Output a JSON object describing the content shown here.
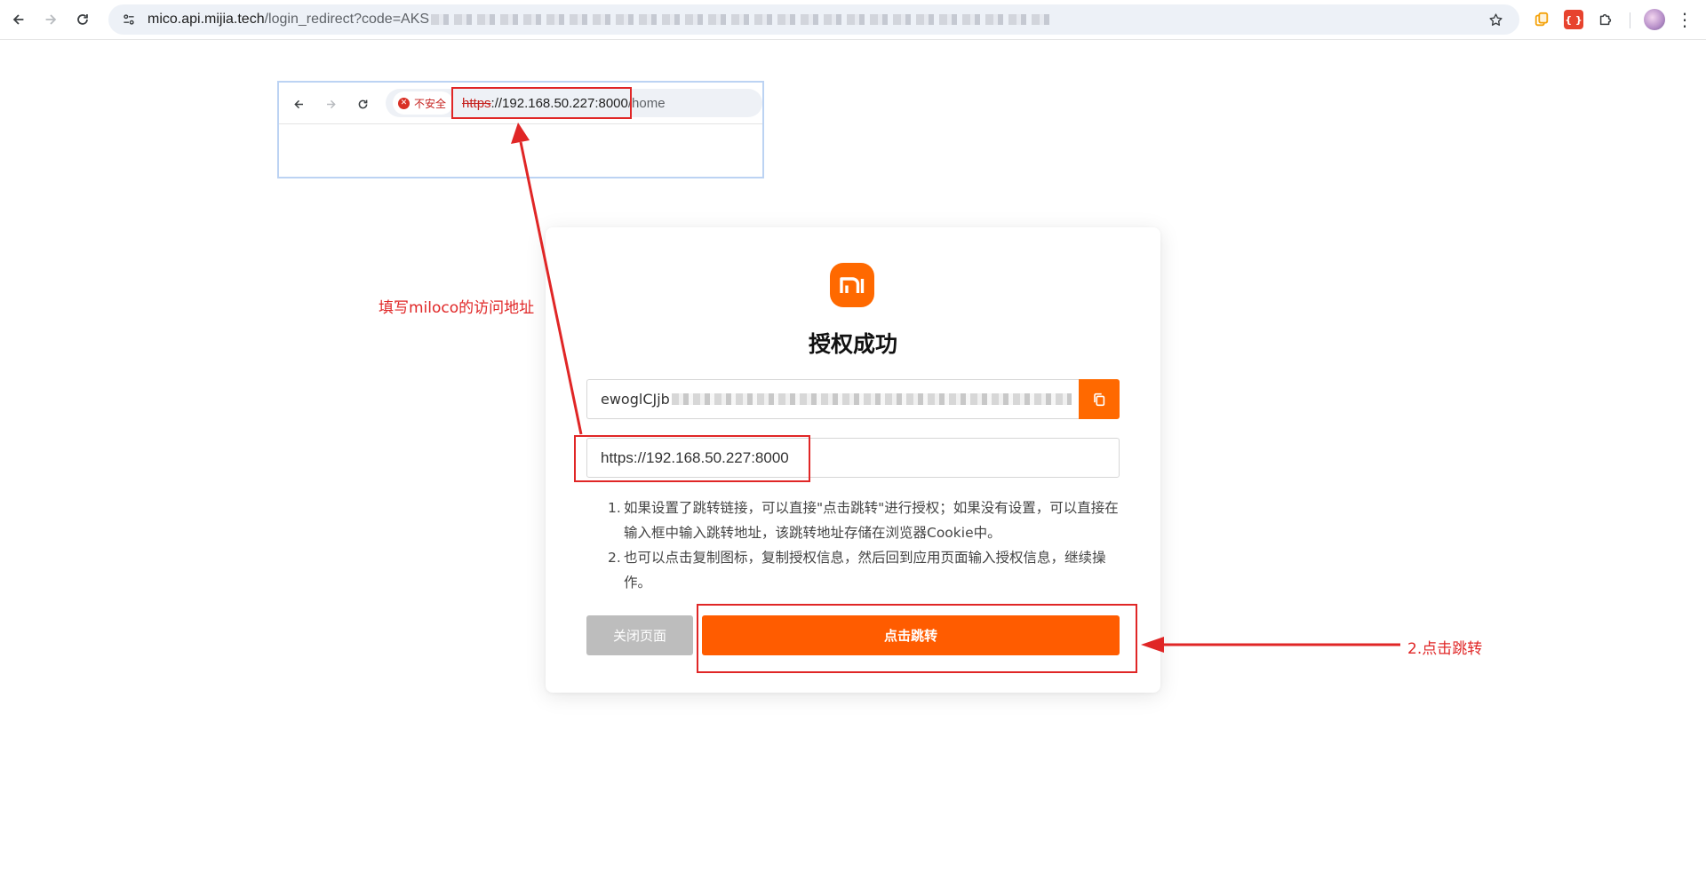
{
  "browser": {
    "url_host": "mico.api.mijia.tech",
    "url_path": "/login_redirect?code=AKS",
    "icons": [
      "back-arrow-icon",
      "forward-arrow-icon",
      "reload-icon",
      "site-info-icon",
      "bookmark-star-icon",
      "extensions-puzzle-icon",
      "kebab-menu-icon"
    ]
  },
  "inset_browser": {
    "security_label": "不安全",
    "url_scheme": "https",
    "url_host": "://192.168.50.227:8000",
    "url_path": "/home"
  },
  "annotations": {
    "fill_address": "填写miloco的访问地址",
    "click_jump": "2.点击跳转",
    "color": "#e02626"
  },
  "card": {
    "title": "授权成功",
    "token_value": "ewoglCJjb",
    "redirect_url": "https://192.168.50.227:8000",
    "notes": [
      {
        "num": "1.",
        "text": "如果设置了跳转链接，可以直接\"点击跳转\"进行授权；如果没有设置，可以直接在输入框中输入跳转地址，该跳转地址存储在浏览器Cookie中。"
      },
      {
        "num": "2.",
        "text": "也可以点击复制图标，复制授权信息，然后回到应用页面输入授权信息，继续操作。"
      }
    ],
    "close_label": "关闭页面",
    "jump_label": "点击跳转",
    "accent_color": "#ff6900"
  }
}
